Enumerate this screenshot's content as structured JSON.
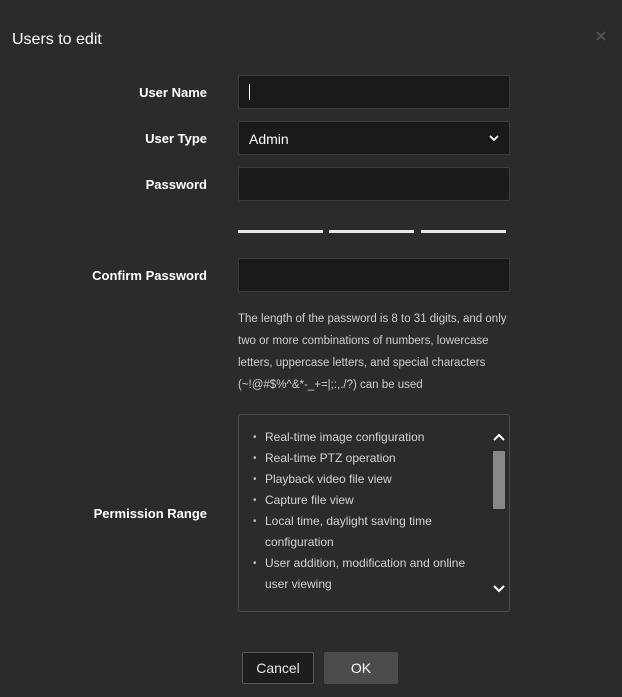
{
  "dialog": {
    "title": "Users to edit",
    "close_icon": "close-icon"
  },
  "form": {
    "user_name": {
      "label": "User Name",
      "value": ""
    },
    "user_type": {
      "label": "User Type",
      "value": "Admin"
    },
    "password": {
      "label": "Password",
      "value": ""
    },
    "confirm_password": {
      "label": "Confirm Password",
      "value": ""
    },
    "password_hint": "The length of the password is 8 to 31 digits, and only two or more combinations of numbers, lowercase letters, uppercase letters, and special characters (~!@#$%^&*-_+=|;:,./?) can be used",
    "permission_range": {
      "label": "Permission Range",
      "items": [
        "Real-time image configuration",
        "Real-time PTZ operation",
        "Playback video file view",
        "Capture file view",
        "Local time, daylight saving time configuration",
        "User addition, modification and online user viewing"
      ]
    }
  },
  "buttons": {
    "cancel": "Cancel",
    "ok": "OK"
  },
  "colors": {
    "dialog_bg": "#2b2b2b",
    "field_bg": "#1a1a1a",
    "strength_bar": "#e9e9e9"
  }
}
